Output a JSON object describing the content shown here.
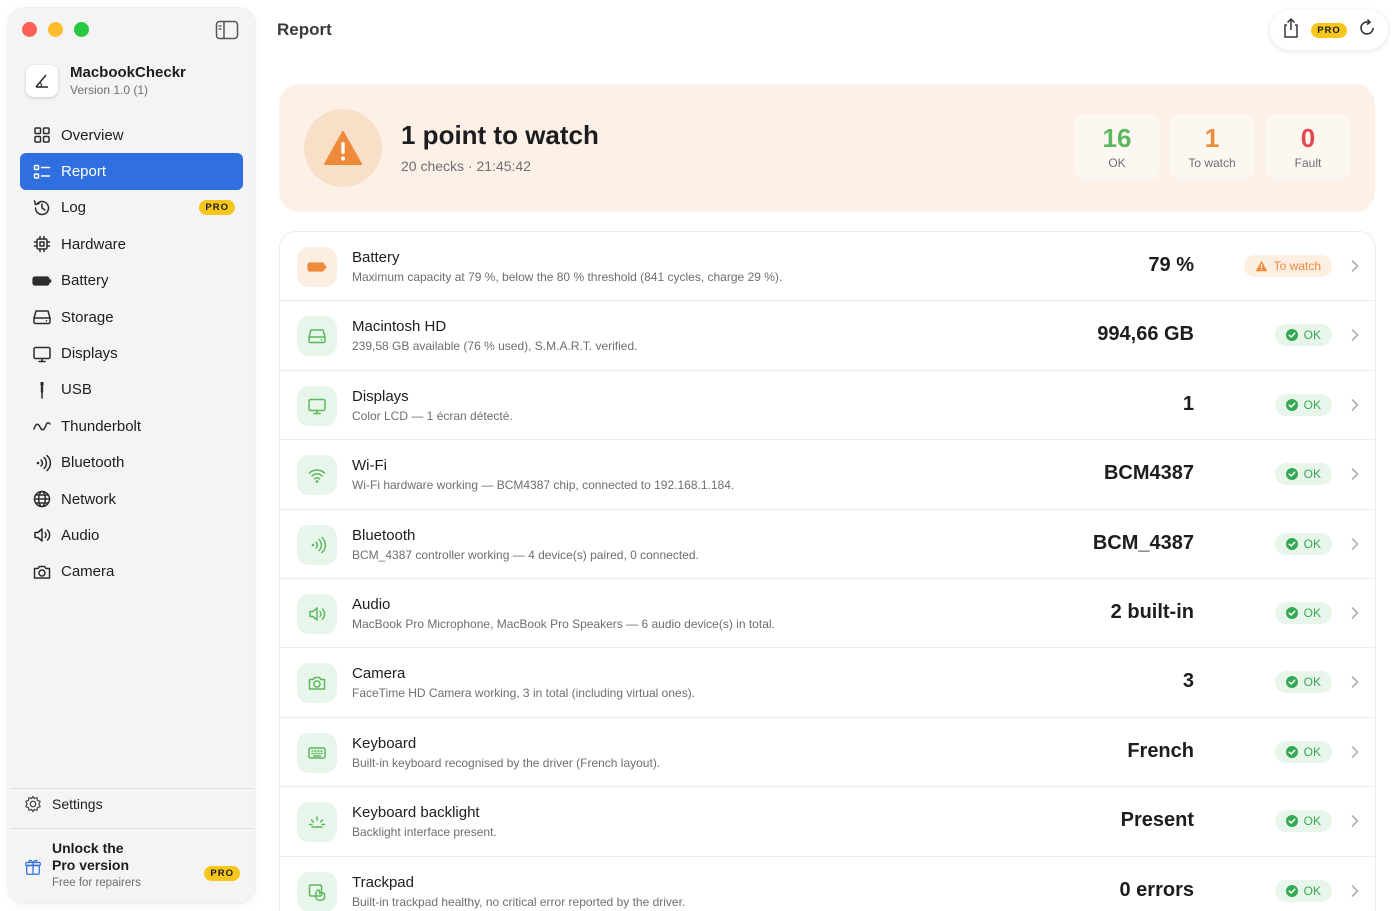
{
  "app": {
    "name": "MacbookCheckr",
    "version": "Version 1.0 (1)"
  },
  "sidebar": {
    "items": [
      {
        "label": "Overview",
        "icon": "overview-icon"
      },
      {
        "label": "Report",
        "icon": "report-icon",
        "active": true
      },
      {
        "label": "Log",
        "icon": "log-icon",
        "badge": "PRO"
      },
      {
        "label": "Hardware",
        "icon": "chip-icon"
      },
      {
        "label": "Battery",
        "icon": "battery-icon"
      },
      {
        "label": "Storage",
        "icon": "storage-icon"
      },
      {
        "label": "Displays",
        "icon": "display-icon"
      },
      {
        "label": "USB",
        "icon": "usb-icon"
      },
      {
        "label": "Thunderbolt",
        "icon": "thunderbolt-icon"
      },
      {
        "label": "Bluetooth",
        "icon": "bluetooth-icon"
      },
      {
        "label": "Network",
        "icon": "globe-icon"
      },
      {
        "label": "Audio",
        "icon": "speaker-icon"
      },
      {
        "label": "Camera",
        "icon": "camera-icon"
      }
    ],
    "settings_label": "Settings",
    "unlock": {
      "title_line1": "Unlock the",
      "title_line2": "Pro version",
      "subtitle": "Free for repairers",
      "badge": "PRO"
    }
  },
  "header": {
    "title": "Report",
    "pro_badge": "PRO"
  },
  "summary": {
    "title": "1 point to watch",
    "subtitle": "20 checks · 21:45:42",
    "stats": [
      {
        "value": "16",
        "label": "OK",
        "color": "#5cb85c"
      },
      {
        "value": "1",
        "label": "To watch",
        "color": "#ee8a3a"
      },
      {
        "value": "0",
        "label": "Fault",
        "color": "#e5484d"
      }
    ]
  },
  "checks": [
    {
      "title": "Battery",
      "desc": "Maximum capacity at 79 %, below the 80 % threshold (841 cycles, charge 29 %).",
      "value": "79 %",
      "status": "To watch",
      "level": "warn",
      "icon": "battery-icon"
    },
    {
      "title": "Macintosh HD",
      "desc": "239,58 GB available (76 % used), S.M.A.R.T. verified.",
      "value": "994,66 GB",
      "status": "OK",
      "level": "ok",
      "icon": "storage-icon"
    },
    {
      "title": "Displays",
      "desc": "Color LCD — 1 écran détecté.",
      "value": "1",
      "status": "OK",
      "level": "ok",
      "icon": "display-icon"
    },
    {
      "title": "Wi-Fi",
      "desc": "Wi-Fi hardware working — BCM4387 chip, connected to 192.168.1.184.",
      "value": "BCM4387",
      "status": "OK",
      "level": "ok",
      "icon": "wifi-icon"
    },
    {
      "title": "Bluetooth",
      "desc": "BCM_4387 controller working — 4 device(s) paired, 0 connected.",
      "value": "BCM_4387",
      "status": "OK",
      "level": "ok",
      "icon": "bluetooth-icon"
    },
    {
      "title": "Audio",
      "desc": "MacBook Pro Microphone, MacBook Pro Speakers — 6 audio device(s) in total.",
      "value": "2 built-in",
      "status": "OK",
      "level": "ok",
      "icon": "speaker-icon"
    },
    {
      "title": "Camera",
      "desc": "FaceTime HD Camera working, 3 in total (including virtual ones).",
      "value": "3",
      "status": "OK",
      "level": "ok",
      "icon": "camera-icon"
    },
    {
      "title": "Keyboard",
      "desc": "Built-in keyboard recognised by the driver (French layout).",
      "value": "French",
      "status": "OK",
      "level": "ok",
      "icon": "keyboard-icon"
    },
    {
      "title": "Keyboard backlight",
      "desc": "Backlight interface present.",
      "value": "Present",
      "status": "OK",
      "level": "ok",
      "icon": "backlight-icon"
    },
    {
      "title": "Trackpad",
      "desc": "Built-in trackpad healthy, no critical error reported by the driver.",
      "value": "0 errors",
      "status": "OK",
      "level": "ok",
      "icon": "trackpad-icon"
    }
  ],
  "colors": {
    "accent": "#2f6fdf",
    "ok": "#34a853",
    "warn": "#ee8a3a",
    "fault": "#e5484d",
    "pro": "#f7c61c"
  }
}
